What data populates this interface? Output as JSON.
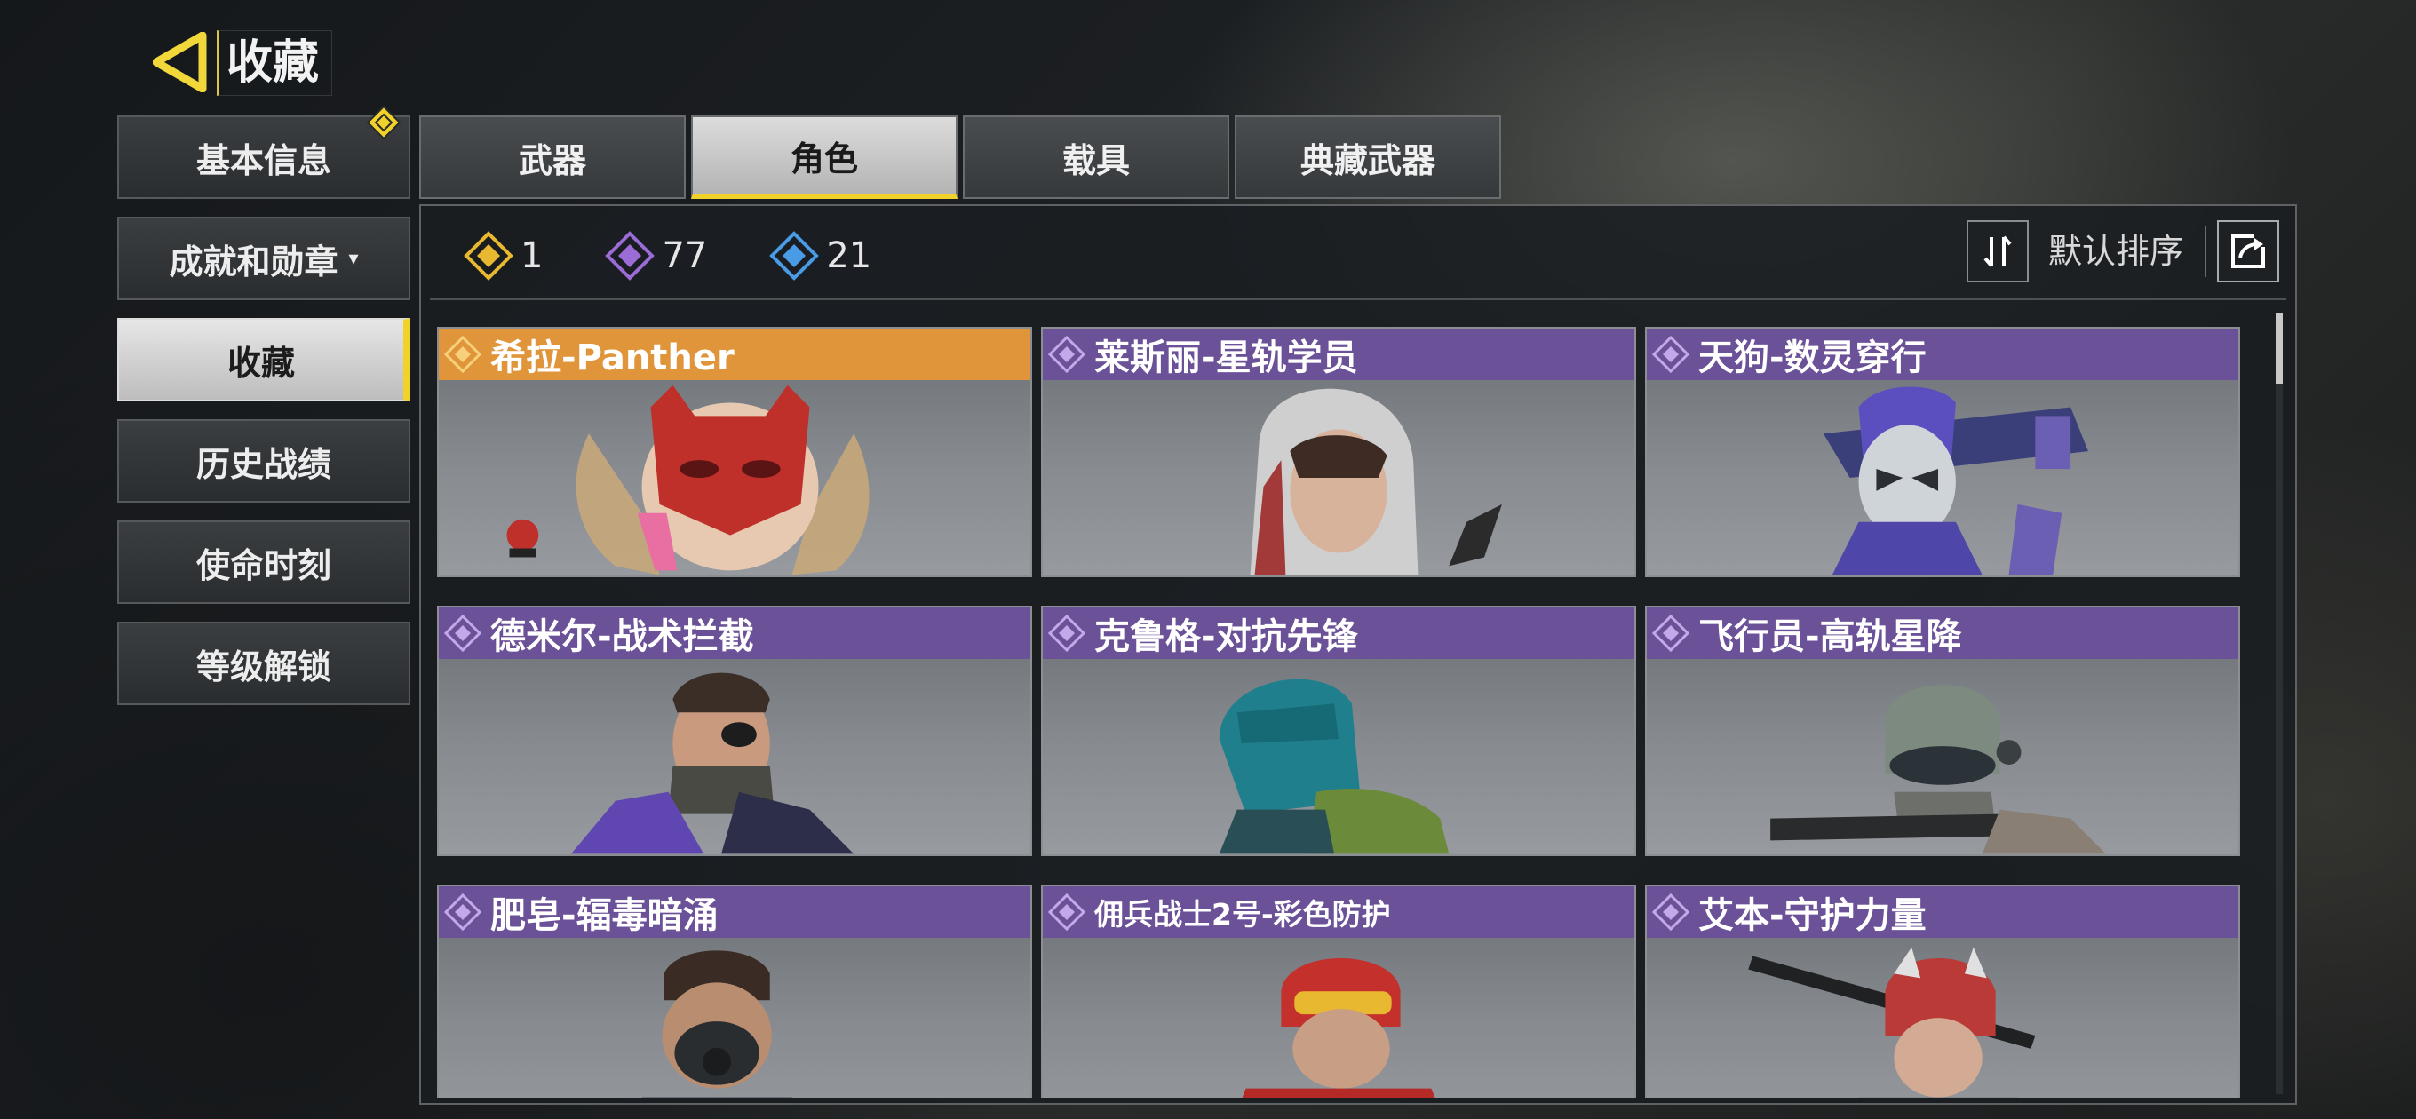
{
  "header": {
    "title": "收藏"
  },
  "sidebar": {
    "items": [
      {
        "label": "基本信息"
      },
      {
        "label": "成就和勋章",
        "caret": "▾"
      },
      {
        "label": "收藏"
      },
      {
        "label": "历史战绩"
      },
      {
        "label": "使命时刻"
      },
      {
        "label": "等级解锁"
      }
    ],
    "active_index": 2
  },
  "tabs": [
    {
      "label": "武器"
    },
    {
      "label": "角色"
    },
    {
      "label": "载具"
    },
    {
      "label": "典藏武器"
    }
  ],
  "active_tab": 1,
  "counts": [
    {
      "rarity": "legendary",
      "color": "#e8b930",
      "value": "1"
    },
    {
      "rarity": "epic",
      "color": "#9b6bd6",
      "value": "77"
    },
    {
      "rarity": "rare",
      "color": "#4a9be6",
      "value": "21"
    }
  ],
  "sort": {
    "label": "默认排序",
    "icon": "sort-icon"
  },
  "share": {
    "icon": "share-icon"
  },
  "colors": {
    "accent": "#f0d22a",
    "legendary_header": "#e0953a",
    "epic_header": "#6b5197"
  },
  "cards": [
    {
      "name": "希拉-Panther",
      "rarity": "legendary"
    },
    {
      "name": "莱斯丽-星轨学员",
      "rarity": "epic"
    },
    {
      "name": "天狗-数灵穿行",
      "rarity": "epic"
    },
    {
      "name": "德米尔-战术拦截",
      "rarity": "epic"
    },
    {
      "name": "克鲁格-对抗先锋",
      "rarity": "epic"
    },
    {
      "name": "飞行员-高轨星降",
      "rarity": "epic"
    },
    {
      "name": "肥皂-辐毒暗涌",
      "rarity": "epic"
    },
    {
      "name": "佣兵战士2号-彩色防护",
      "rarity": "epic"
    },
    {
      "name": "艾本-守护力量",
      "rarity": "epic"
    }
  ]
}
